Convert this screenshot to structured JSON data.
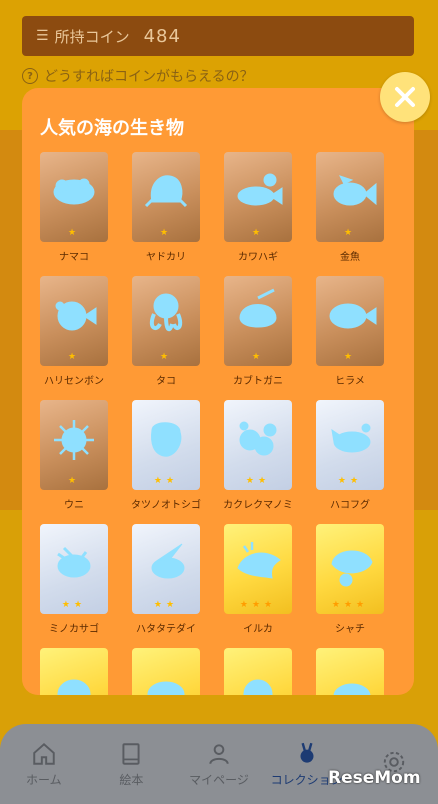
{
  "header": {
    "coin_label": "所持コイン",
    "coin_value": "484",
    "help_text": "どうすればコインがもらえるの？"
  },
  "modal": {
    "title": "人気の海の生き物",
    "close_icon": "close-x-icon",
    "creatures": [
      {
        "name": "ナマコ",
        "tier": "bronze",
        "stars": "★",
        "icon": "sea-cucumber-silhouette"
      },
      {
        "name": "ヤドカリ",
        "tier": "bronze",
        "stars": "★",
        "icon": "hermit-crab-silhouette"
      },
      {
        "name": "カワハギ",
        "tier": "bronze",
        "stars": "★",
        "icon": "filefish-silhouette"
      },
      {
        "name": "金魚",
        "tier": "bronze",
        "stars": "★",
        "icon": "goldfish-silhouette"
      },
      {
        "name": "ハリセンボン",
        "tier": "bronze",
        "stars": "★",
        "icon": "porcupinefish-silhouette"
      },
      {
        "name": "タコ",
        "tier": "bronze",
        "stars": "★",
        "icon": "octopus-silhouette"
      },
      {
        "name": "カブトガニ",
        "tier": "bronze",
        "stars": "★",
        "icon": "horseshoe-crab-silhouette"
      },
      {
        "name": "ヒラメ",
        "tier": "bronze",
        "stars": "★",
        "icon": "flounder-silhouette"
      },
      {
        "name": "ウニ",
        "tier": "bronze",
        "stars": "★",
        "icon": "sea-urchin-silhouette"
      },
      {
        "name": "タツノオトシゴ",
        "tier": "silver",
        "stars": "★★",
        "icon": "seahorse-silhouette"
      },
      {
        "name": "カクレクマノミ",
        "tier": "silver",
        "stars": "★★",
        "icon": "clownfish-silhouette"
      },
      {
        "name": "ハコフグ",
        "tier": "silver",
        "stars": "★★",
        "icon": "boxfish-silhouette"
      },
      {
        "name": "ミノカサゴ",
        "tier": "silver",
        "stars": "★★",
        "icon": "lionfish-silhouette"
      },
      {
        "name": "ハタタテダイ",
        "tier": "silver",
        "stars": "★★",
        "icon": "bannerfish-silhouette"
      },
      {
        "name": "イルカ",
        "tier": "gold",
        "stars": "★★★",
        "icon": "dolphin-silhouette"
      },
      {
        "name": "シャチ",
        "tier": "gold",
        "stars": "★★★",
        "icon": "orca-silhouette"
      },
      {
        "name": "",
        "tier": "gold",
        "stars": "",
        "icon": "creature-silhouette"
      },
      {
        "name": "",
        "tier": "gold",
        "stars": "",
        "icon": "creature-silhouette"
      },
      {
        "name": "",
        "tier": "gold",
        "stars": "",
        "icon": "creature-silhouette"
      },
      {
        "name": "",
        "tier": "gold",
        "stars": "",
        "icon": "creature-silhouette"
      }
    ]
  },
  "nav": {
    "items": [
      {
        "label": "ホーム",
        "icon": "home-icon"
      },
      {
        "label": "絵本",
        "icon": "book-icon"
      },
      {
        "label": "マイページ",
        "icon": "person-icon"
      },
      {
        "label": "コレクション",
        "icon": "medal-icon"
      },
      {
        "label": "",
        "icon": "gear-icon"
      }
    ]
  },
  "watermark": "ReseMom",
  "colors": {
    "modal_bg": "#ff9a35",
    "silhouette": "#8fe0ff",
    "close_button": "#ffe27a"
  }
}
